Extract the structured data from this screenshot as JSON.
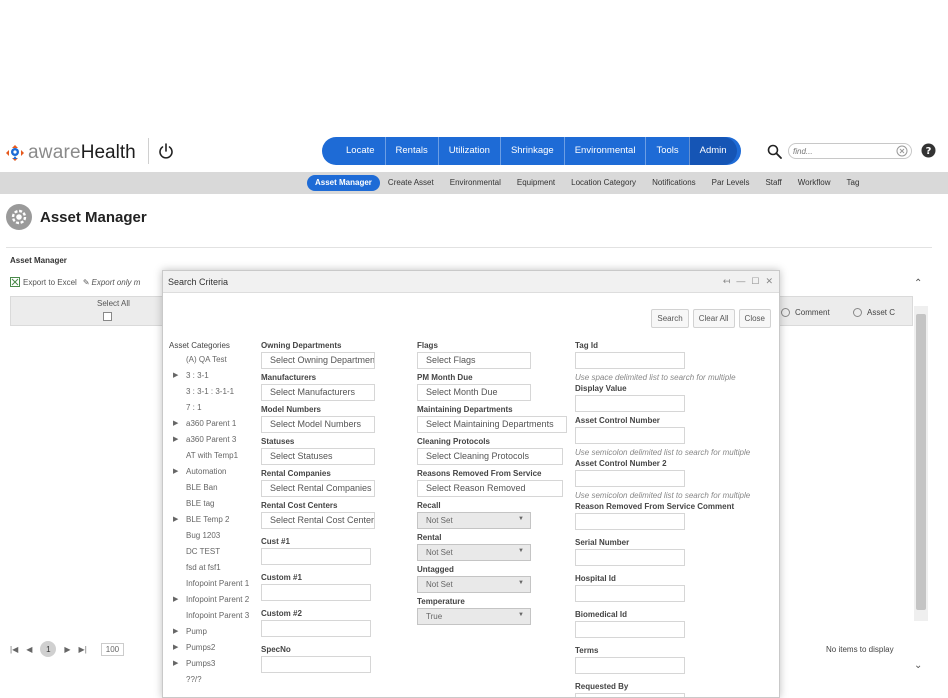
{
  "logo": {
    "word1": "aware",
    "word2": "Health"
  },
  "main_nav": [
    "Locate",
    "Rentals",
    "Utilization",
    "Shrinkage",
    "Environmental",
    "Tools",
    "Admin"
  ],
  "search": {
    "placeholder": "find..."
  },
  "sub_nav": [
    "Asset Manager",
    "Create Asset",
    "Environmental",
    "Equipment",
    "Location Category",
    "Notifications",
    "Par Levels",
    "Staff",
    "Workflow",
    "Tag"
  ],
  "page_title": "Asset Manager",
  "panel": {
    "label": "Asset Manager",
    "export_excel": "Export to Excel",
    "export_only": "Export only m",
    "select_all": "Select All",
    "col_comment": "Comment",
    "col_asset": "Asset C",
    "page_current": "1",
    "page_size": "100",
    "no_items": "No items to display"
  },
  "dialog": {
    "title": "Search Criteria",
    "buttons": {
      "search": "Search",
      "clear_all": "Clear All",
      "close": "Close"
    },
    "categories_head": "Asset Categories",
    "categories": [
      {
        "label": "(A) QA Test",
        "expandable": false
      },
      {
        "label": "3 : 3-1",
        "expandable": true
      },
      {
        "label": "3 : 3-1 : 3-1-1",
        "expandable": false
      },
      {
        "label": "7 : 1",
        "expandable": false
      },
      {
        "label": "a360 Parent 1",
        "expandable": true
      },
      {
        "label": "a360 Parent 3",
        "expandable": true
      },
      {
        "label": "AT with Temp1",
        "expandable": false
      },
      {
        "label": "Automation",
        "expandable": true
      },
      {
        "label": "BLE Ban",
        "expandable": false
      },
      {
        "label": "BLE tag",
        "expandable": false
      },
      {
        "label": "BLE Temp 2",
        "expandable": true
      },
      {
        "label": "Bug 1203",
        "expandable": false
      },
      {
        "label": "DC TEST",
        "expandable": false
      },
      {
        "label": "fsd at fsf1",
        "expandable": false
      },
      {
        "label": "Infopoint Parent 1",
        "expandable": false
      },
      {
        "label": "Infopoint Parent 2",
        "expandable": true
      },
      {
        "label": "Infopoint Parent 3",
        "expandable": false
      },
      {
        "label": "Pump",
        "expandable": true
      },
      {
        "label": "Pumps2",
        "expandable": true
      },
      {
        "label": "Pumps3",
        "expandable": true
      },
      {
        "label": "??/?",
        "expandable": false
      }
    ],
    "col2": {
      "owning_departments": {
        "label": "Owning Departments",
        "value": "Select Owning Departments"
      },
      "manufacturers": {
        "label": "Manufacturers",
        "value": "Select Manufacturers"
      },
      "model_numbers": {
        "label": "Model Numbers",
        "value": "Select Model Numbers"
      },
      "statuses": {
        "label": "Statuses",
        "value": "Select Statuses"
      },
      "rental_companies": {
        "label": "Rental Companies",
        "value": "Select Rental Companies"
      },
      "rental_cost_centers": {
        "label": "Rental Cost Centers",
        "value": "Select Rental Cost Centers"
      },
      "cust1": "Cust #1",
      "custom1": "Custom #1",
      "custom2": "Custom #2",
      "specno": "SpecNo"
    },
    "col3": {
      "flags": {
        "label": "Flags",
        "value": "Select Flags"
      },
      "pm_month_due": {
        "label": "PM Month Due",
        "value": "Select Month Due"
      },
      "maintaining_departments": {
        "label": "Maintaining Departments",
        "value": "Select Maintaining Departments"
      },
      "cleaning_protocols": {
        "label": "Cleaning Protocols",
        "value": "Select Cleaning Protocols"
      },
      "reasons_removed": {
        "label": "Reasons Removed From Service",
        "value": "Select Reason Removed"
      },
      "recall": {
        "label": "Recall",
        "value": "Not Set"
      },
      "rental": {
        "label": "Rental",
        "value": "Not Set"
      },
      "untagged": {
        "label": "Untagged",
        "value": "Not Set"
      },
      "temperature": {
        "label": "Temperature",
        "value": "True"
      }
    },
    "col4": {
      "tag_id": "Tag Id",
      "hint_space": "Use space delimited list to search for multiple",
      "display_value": "Display Value",
      "asset_control_number": "Asset Control Number",
      "hint_semicolon": "Use semicolon delimited list to search for multiple",
      "asset_control_number2": "Asset Control Number 2",
      "reason_removed_comment": "Reason Removed From Service Comment",
      "serial_number": "Serial Number",
      "hospital_id": "Hospital Id",
      "biomedical_id": "Biomedical Id",
      "terms": "Terms",
      "requested_by": "Requested By"
    }
  },
  "colors": {
    "nav_blue": "#1e6bd6",
    "nav_active": "#1555b5",
    "subnav_bg": "#d9d9d9"
  }
}
